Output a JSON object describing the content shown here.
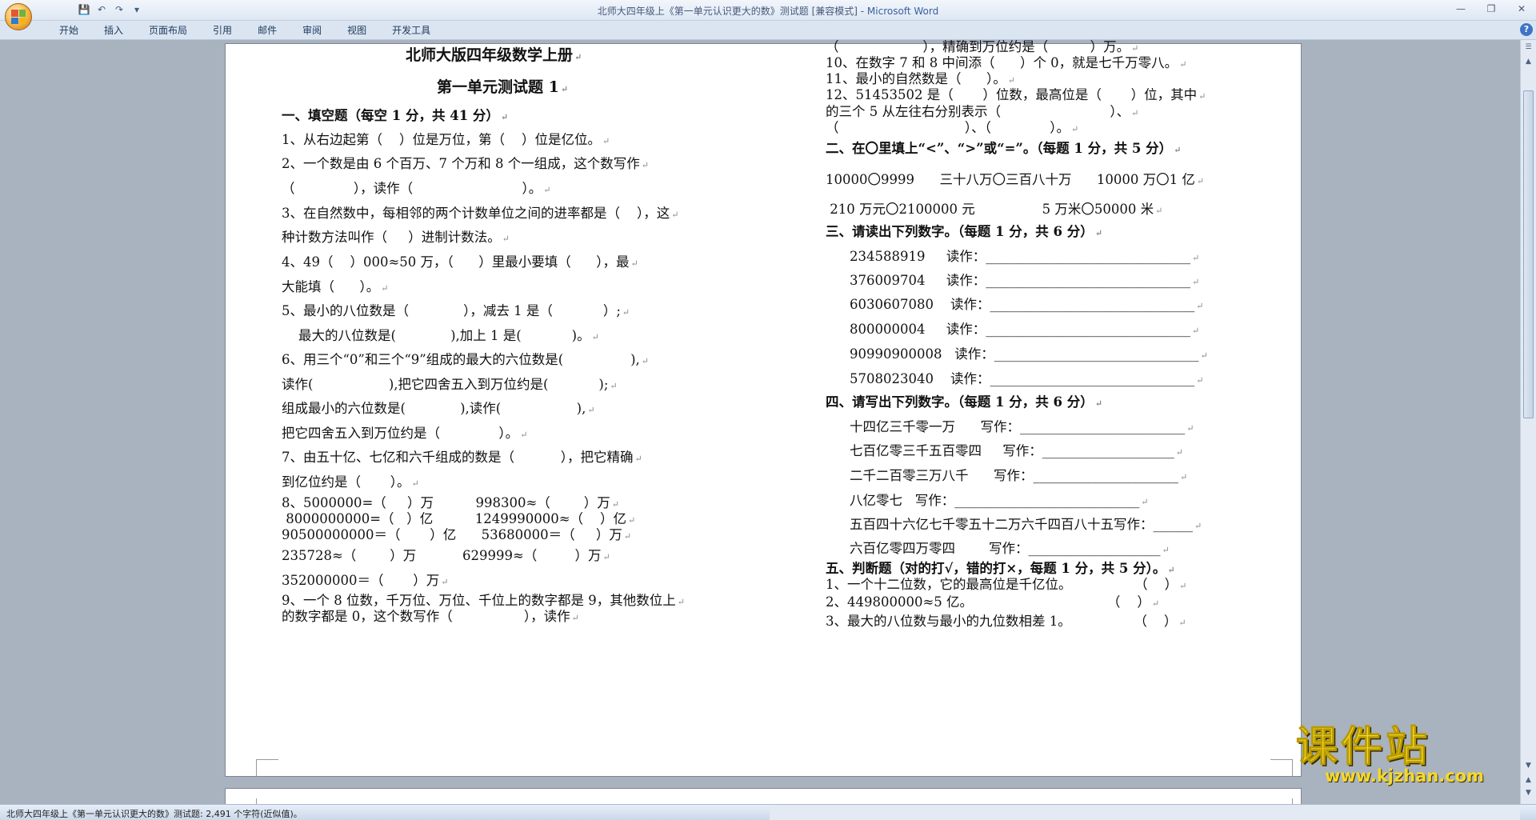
{
  "window": {
    "title_main": "北师大四年级上《第一单元认识更大的数》测试题 [兼容模式] - ",
    "title_brand": "Microsoft Word"
  },
  "ribbon": {
    "tabs": [
      "开始",
      "插入",
      "页面布局",
      "引用",
      "邮件",
      "审阅",
      "视图",
      "开发工具"
    ]
  },
  "icons": {
    "office": "office-logo-icon",
    "save": "save-icon",
    "undo": "undo-icon",
    "redo": "redo-icon",
    "customize": "dropdown-icon",
    "minimize": "minimize-icon",
    "restore": "restore-icon",
    "close": "close-icon",
    "help": "help-icon"
  },
  "colors": {
    "title_brand": "#3a5f9c",
    "watermark": "#f4d92c"
  },
  "doc": {
    "left": [
      {
        "text": "北师大版四年级数学上册",
        "style": "title"
      },
      {
        "text": "第一单元测试题 1",
        "style": "title"
      },
      {
        "text": "一、填空题（每空 1 分，共 41 分）",
        "style": "b"
      },
      {
        "text": "1、从右边起第（    ）位是万位，第（    ）位是亿位。"
      },
      {
        "text": "2、一个数是由 6 个百万、7 个万和 8 个一组成，这个数写作"
      },
      {
        "text": "（              ），读作（                          ）。"
      },
      {
        "text": "3、在自然数中，每相邻的两个计数单位之间的进率都是（    ），这"
      },
      {
        "text": "种计数方法叫作（     ）进制计数法。"
      },
      {
        "text": "4、49（    ）000≈50 万，（      ）里最小要填（      ），最"
      },
      {
        "text": "大能填（      ）。"
      },
      {
        "text": "5、最小的八位数是（             ），减去 1 是（            ）;"
      },
      {
        "text": "    最大的八位数是(             ),加上 1 是(            )。"
      },
      {
        "text": "6、用三个“0”和三个“9”组成的最大的六位数是(                ),"
      },
      {
        "text": "读作(                  ),把它四舍五入到万位约是(            );"
      },
      {
        "text": "组成最小的六位数是(             ),读作(                  ),"
      },
      {
        "text": "把它四舍五入到万位约是（              ）。"
      },
      {
        "text": "7、由五十亿、七亿和六千组成的数是（           ），把它精确"
      },
      {
        "text": "到亿位约是（       ）。"
      },
      {
        "text": "8、5000000=（     ）万          998300≈（        ）万"
      },
      {
        "text": " 8000000000=（   ）亿          1249990000≈（    ）亿"
      },
      {
        "text": "90500000000＝（       ）亿      53680000＝（     ）万"
      },
      {
        "text": "235728≈（        ）万           629999≈（         ）万"
      },
      {
        "text": "352000000＝（       ）万"
      },
      {
        "text": "9、一个 8 位数，千万位、万位、千位上的数字都是 9，其他数位上"
      },
      {
        "text": "的数字都是 0，这个数写作（                 ），读作"
      }
    ],
    "right": [
      {
        "text": "（                    ），精确到万位约是（          ）万。"
      },
      {
        "text": "10、在数字 7 和 8 中间添（      ）个 0，就是七千万零八。"
      },
      {
        "text": "11、最小的自然数是（      ）。"
      },
      {
        "text": "12、51453502 是（       ）位数，最高位是（       ）位，其中"
      },
      {
        "text": "的三个 5 从左往右分别表示（                          ）、"
      },
      {
        "text": "（                              ）、（              ）。"
      },
      {
        "text": "二、在〇里填上“<”、“>”或“=”。（每题 1 分，共 5 分）",
        "style": "b"
      },
      {
        "text": "10000〇9999      三十八万〇三百八十万      10000 万〇1 亿"
      },
      {
        "text": " 210 万元〇2100000 元                5 万米〇50000 米"
      },
      {
        "text": "三、请读出下列数字。（每题 1 分，共 6 分）",
        "style": "b"
      },
      {
        "text": "234588919     读作：_______________________________"
      },
      {
        "text": "376009704     读作：_______________________________"
      },
      {
        "text": "6030607080    读作：_______________________________"
      },
      {
        "text": "800000004     读作：_______________________________"
      },
      {
        "text": "90990900008   读作：_______________________________"
      },
      {
        "text": "5708023040    读作：_______________________________"
      },
      {
        "text": "四、请写出下列数字。（每题 1 分，共 6 分）",
        "style": "b"
      },
      {
        "text": "十四亿三千零一万      写作：_________________________"
      },
      {
        "text": "七百亿零三千五百零四     写作：____________________"
      },
      {
        "text": "二千二百零三万八千      写作：______________________"
      },
      {
        "text": "八亿零七   写作：____________________________"
      },
      {
        "text": "五百四十六亿七千零五十二万六千四百八十五写作：______"
      },
      {
        "text": "六百亿零四万零四        写作：____________________"
      },
      {
        "text": "五、判断题（对的打√，错的打×，每题 1 分，共 5 分）。",
        "style": "b"
      },
      {
        "text": "1、一个十二位数，它的最高位是千亿位。               （    ）"
      },
      {
        "text": "2、449800000≈5 亿。                                （    ）"
      },
      {
        "text": "3、最大的八位数与最小的九位数相差 1。               （    ）"
      }
    ]
  },
  "status": {
    "text": "北师大四年级上《第一单元认识更大的数》测试题: 2,491 个字符(近似值)。"
  },
  "watermark": {
    "main": "课件站",
    "url": "www.kjzhan.com"
  }
}
